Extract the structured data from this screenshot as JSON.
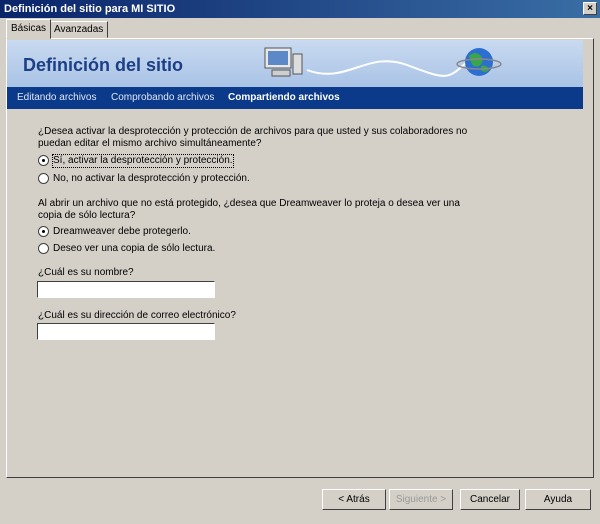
{
  "window": {
    "title": "Definición del sitio para MI SITIO",
    "close_glyph": "×"
  },
  "tabs": [
    {
      "label": "Básicas",
      "active": true
    },
    {
      "label": "Avanzadas",
      "active": false
    }
  ],
  "banner": {
    "heading": "Definición del sitio",
    "steps": [
      {
        "label": "Editando archivos",
        "current": false
      },
      {
        "label": "Comprobando archivos",
        "current": false
      },
      {
        "label": "Compartiendo archivos",
        "current": true
      }
    ]
  },
  "question1": {
    "text_line1": "¿Desea activar la desprotección y protección de archivos para que usted y sus colaboradores no",
    "text_line2": "puedan editar el mismo archivo simultáneamente?",
    "options": [
      {
        "label": "Sí, activar la desprotección y protección.",
        "checked": true
      },
      {
        "label": "No, no activar la desprotección y protección.",
        "checked": false
      }
    ]
  },
  "question2": {
    "text_line1": "Al abrir un archivo que no está protegido, ¿desea que Dreamweaver lo proteja o desea ver una",
    "text_line2": "copia de sólo lectura?",
    "options": [
      {
        "label": "Dreamweaver debe protegerlo.",
        "checked": true
      },
      {
        "label": "Deseo ver una copia de sólo lectura.",
        "checked": false
      }
    ]
  },
  "name_field": {
    "label": "¿Cuál es su nombre?",
    "value": ""
  },
  "email_field": {
    "label": "¿Cuál es su dirección de correo electrónico?",
    "value": ""
  },
  "buttons": {
    "back": "< Atrás",
    "next": "Siguiente >",
    "cancel": "Cancelar",
    "help": "Ayuda"
  },
  "icons": [
    "computer-icon",
    "globe-icon",
    "close-icon"
  ]
}
